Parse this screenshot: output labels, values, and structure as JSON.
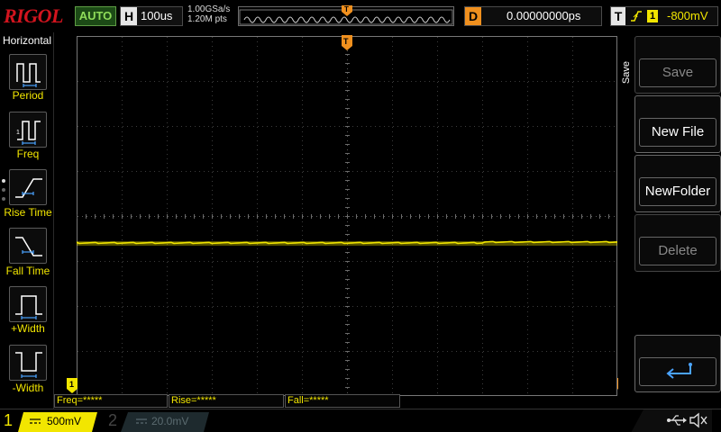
{
  "brand": "RIGOL",
  "topbar": {
    "auto_label": "AUTO",
    "horizontal_label": "H",
    "timebase": "100us",
    "sample_rate": "1.00GSa/s",
    "memory_depth": "1.20M pts",
    "trigger_marker": "T",
    "delay_label": "D",
    "delay_value": "0.00000000ps",
    "trigger_label": "T",
    "trigger_source": "1",
    "trigger_level": "-800mV"
  },
  "left_panel": {
    "title": "Horizontal",
    "items": [
      {
        "label": "Period",
        "icon": "period-icon"
      },
      {
        "label": "Freq",
        "icon": "freq-icon"
      },
      {
        "label": "Rise Time",
        "icon": "rise-time-icon"
      },
      {
        "label": "Fall Time",
        "icon": "fall-time-icon"
      },
      {
        "label": "+Width",
        "icon": "positive-width-icon"
      },
      {
        "label": "-Width",
        "icon": "negative-width-icon"
      }
    ]
  },
  "right_panel": {
    "tab_label": "Save",
    "buttons": [
      {
        "label": "Save",
        "enabled": false
      },
      {
        "label": "New File",
        "enabled": true
      },
      {
        "label": "NewFolder",
        "enabled": true
      },
      {
        "label": "Delete",
        "enabled": false
      },
      {
        "label": "",
        "icon": "return-icon",
        "enabled": true
      }
    ]
  },
  "measurements": [
    {
      "label": "Freq=*****"
    },
    {
      "label": "Rise=*****"
    },
    {
      "label": "Fall=*****"
    }
  ],
  "channels": [
    {
      "number": "1",
      "scale": "500mV",
      "active": true
    },
    {
      "number": "2",
      "scale": "20.0mV",
      "active": false
    }
  ],
  "markers": {
    "ch1_ground": "1",
    "trigger_level": "T"
  },
  "colors": {
    "ch1": "#f2e600",
    "brand": "#d2141e",
    "auto": "#8fdc5a",
    "delay": "#f0901e",
    "trigger": "#f0901e",
    "grid": "#3c3c3c"
  }
}
